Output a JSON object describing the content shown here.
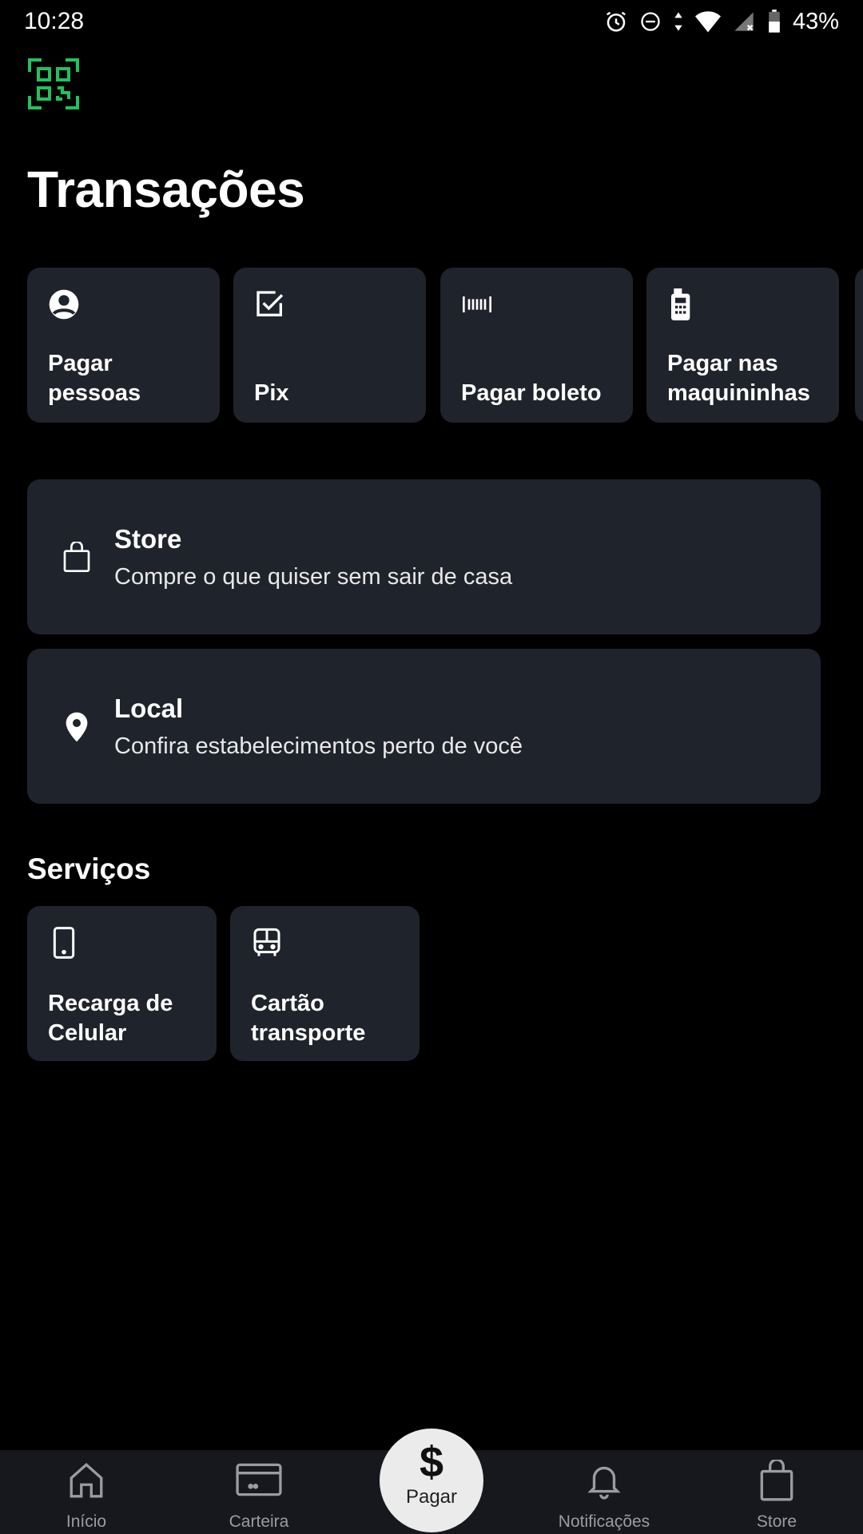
{
  "status_bar": {
    "time": "10:28",
    "battery": "43%",
    "icons": [
      "alarm-icon",
      "dnd-icon",
      "data-arrows-icon",
      "wifi-icon",
      "signal-icon",
      "battery-icon"
    ]
  },
  "header": {
    "qr_icon": "qr-code-icon",
    "title": "Transações"
  },
  "transactions": [
    {
      "icon": "person-circle-icon",
      "label": "Pagar pessoas"
    },
    {
      "icon": "checkbox-icon",
      "label": "Pix"
    },
    {
      "icon": "barcode-icon",
      "label": "Pagar boleto"
    },
    {
      "icon": "card-machine-icon",
      "label": "Pagar nas maquininhas"
    }
  ],
  "store_card": {
    "icon": "shopping-bag-icon",
    "title": "Store",
    "subtitle": "Compre o que quiser sem sair de casa"
  },
  "local_card": {
    "icon": "location-pin-icon",
    "title": "Local",
    "subtitle": "Confira estabelecimentos perto de você"
  },
  "services": {
    "title": "Serviços",
    "items": [
      {
        "icon": "phone-icon",
        "label": "Recarga de Celular"
      },
      {
        "icon": "bus-icon",
        "label": "Cartão transporte"
      }
    ]
  },
  "bottom_nav": {
    "items": [
      {
        "icon": "home-icon",
        "label": "Início"
      },
      {
        "icon": "wallet-card-icon",
        "label": "Carteira"
      },
      {
        "icon": "bell-icon",
        "label": "Notificações"
      },
      {
        "icon": "shopping-bag-icon",
        "label": "Store"
      }
    ],
    "pay": {
      "symbol": "$",
      "label": "Pagar"
    }
  },
  "colors": {
    "background": "#000000",
    "card": "#1f232b",
    "accent_green": "#21c25e",
    "nav_background": "#16181d",
    "nav_text": "#9a9ca2"
  }
}
